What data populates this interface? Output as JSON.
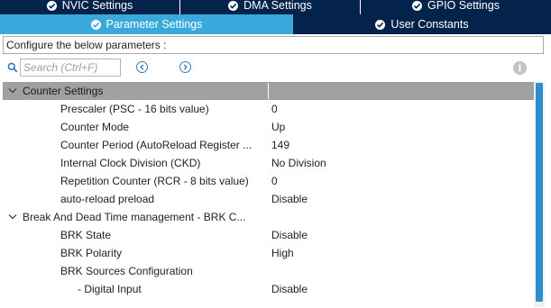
{
  "tabs_row1": [
    {
      "label": "NVIC Settings",
      "icon": "check-circle-icon"
    },
    {
      "label": "DMA Settings",
      "icon": "check-circle-icon"
    },
    {
      "label": "GPIO Settings",
      "icon": "check-circle-icon"
    }
  ],
  "tabs_row2": [
    {
      "label": "Parameter Settings",
      "icon": "check-circle-icon",
      "active": true
    },
    {
      "label": "User Constants",
      "icon": "check-circle-icon",
      "active": false
    }
  ],
  "description": "Configure the below parameters :",
  "search": {
    "placeholder": "Search (Ctrl+F)"
  },
  "colors": {
    "tab_dark": "#03234b",
    "tab_active": "#39a9dc",
    "group_bg": "#a0a0a0",
    "scroll_thumb": "#2d8ed0"
  },
  "groups": [
    {
      "title": "Counter Settings",
      "params": [
        {
          "name": "Prescaler (PSC - 16 bits value)",
          "value": "0"
        },
        {
          "name": "Counter Mode",
          "value": "Up"
        },
        {
          "name": "Counter Period (AutoReload Register ...",
          "value": "149"
        },
        {
          "name": "Internal Clock Division (CKD)",
          "value": "No Division"
        },
        {
          "name": "Repetition Counter (RCR - 8 bits value)",
          "value": "0"
        },
        {
          "name": "auto-reload preload",
          "value": "Disable"
        }
      ]
    },
    {
      "title": "Break And Dead Time management - BRK C...",
      "params": [
        {
          "name": "BRK State",
          "value": "Disable"
        },
        {
          "name": "BRK Polarity",
          "value": "High"
        },
        {
          "name": "BRK Sources Configuration",
          "value": ""
        },
        {
          "name": "- Digital Input",
          "value": "Disable"
        }
      ]
    }
  ]
}
